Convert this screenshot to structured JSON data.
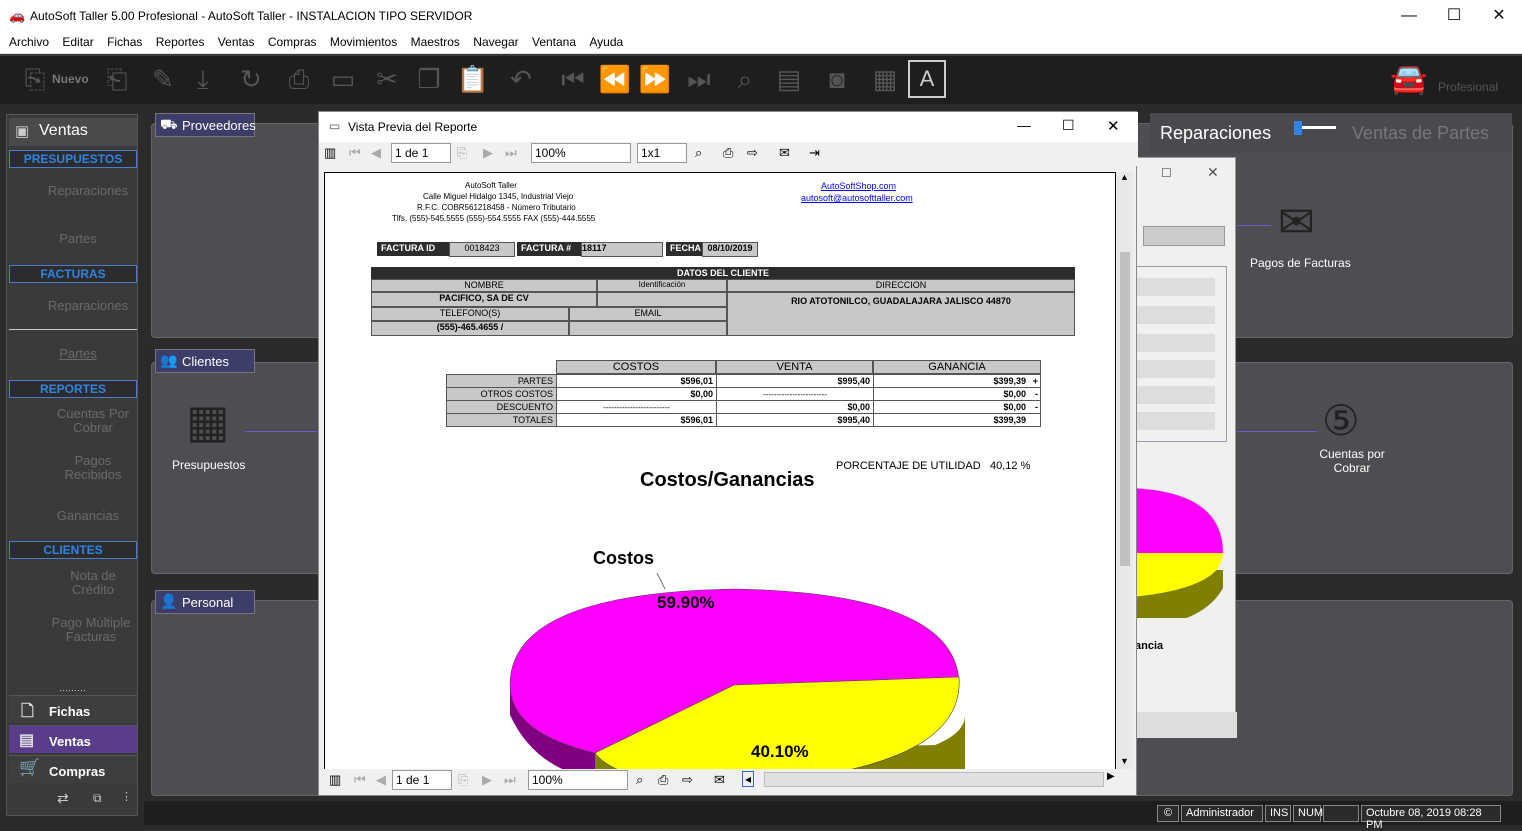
{
  "window": {
    "title": "AutoSoft Taller 5.00 Profesional - AutoSoft Taller - INSTALACION TIPO SERVIDOR",
    "minimize": "—",
    "maximize": "☐",
    "close": "✕"
  },
  "menu": [
    "Archivo",
    "Editar",
    "Fichas",
    "Reportes",
    "Ventas",
    "Compras",
    "Movimientos",
    "Maestros",
    "Navegar",
    "Ventana",
    "Ayuda"
  ],
  "toolbar": {
    "new_label": "Nuevo",
    "edition": "Profesional"
  },
  "sidebar": {
    "title": "Ventas",
    "sections": {
      "presupuestos": "PRESUPUESTOS",
      "facturas": "FACTURAS",
      "reportes": "REPORTES",
      "clientes": "CLIENTES"
    },
    "items": {
      "rep1": "Reparaciones",
      "partes1": "Partes",
      "rep2": "Reparaciones",
      "partes2": "Partes",
      "cuentas": "Cuentas Por Cobrar",
      "pagos": "Pagos Recibidos",
      "ganancias": "Ganancias",
      "nota": "Nota de Crédito",
      "pagomult": "Pago Múltiple Facturas"
    },
    "tabs": {
      "fichas": "Fichas",
      "ventas": "Ventas",
      "compras": "Compras"
    }
  },
  "panels": {
    "proveedores": "Proveedores",
    "clientes": "Clientes",
    "personal": "Personal",
    "presupuestos": "Presupuestos",
    "pagos_facturas": "Pagos de Facturas",
    "cuentas_cobrar": "Cuentas por Cobrar",
    "toggle_left": "Reparaciones",
    "toggle_right": "Ventas de Partes",
    "behind_text": "ancia"
  },
  "report": {
    "title": "Vista Previa del Reporte",
    "page": "1 de 1",
    "zoom": "100%",
    "grid": "1x1",
    "company": {
      "name": "AutoSoft Taller",
      "addr": "Calle Miguel Hidalgo 1345, Industrial Viejo",
      "rfc": "R.F.C. COBR561218458 - Número Tributario",
      "tel": "Tlfs. (555)-545.5555  (555)-554.5555  FAX  (555)-444.5555",
      "web": "AutoSoftShop.com",
      "email": "autosoft@autosofttaller.com"
    },
    "factura_id_label": "FACTURA ID",
    "factura_id": "0018423",
    "factura_num_label": "FACTURA #",
    "factura_num": "18117",
    "fecha_label": "FECHA",
    "fecha": "08/10/2019",
    "cliente": {
      "header": "DATOS DEL CLIENTE",
      "nombre_label": "NOMBRE",
      "ident_label": "Identificación",
      "dir_label": "DIRECCION",
      "nombre": "PACIFICO, SA DE CV",
      "direccion": "RIO ATOTONILCO, GUADALAJARA JALISCO 44870",
      "tel_label": "TELEFONO(S)",
      "email_label": "EMAIL",
      "telefono": "(555)-465.4655 /"
    },
    "costs": {
      "headers": [
        "COSTOS",
        "VENTA",
        "GANANCIA"
      ],
      "rows": [
        [
          "PARTES",
          "$596,01",
          "$995,40",
          "$399,39",
          "+"
        ],
        [
          "OTROS COSTOS",
          "$0,00",
          "------------------------",
          "$0,00",
          "-"
        ],
        [
          "DESCUENTO",
          "-------------------------",
          "$0,00",
          "$0,00",
          "-"
        ],
        [
          "TOTALES",
          "$596,01",
          "$995,40",
          "$399,39",
          ""
        ]
      ]
    },
    "utilidad_label": "PORCENTAJE DE UTILIDAD",
    "utilidad": "40,12  %",
    "chart_title": "Costos/Ganancias",
    "costos_label": "Costos",
    "pct_costos": "59.90%",
    "pct_ganancia": "40.10%"
  },
  "chart_data": {
    "type": "pie",
    "title": "Costos/Ganancias",
    "categories": [
      "Costos",
      "Ganancia"
    ],
    "values": [
      59.9,
      40.1
    ],
    "colors": [
      "#ff00ff",
      "#ffff00"
    ]
  },
  "status": {
    "user": "Administrador",
    "ins": "INS",
    "num": "NUM",
    "datetime": "Octubre 08, 2019 08:28 PM"
  }
}
